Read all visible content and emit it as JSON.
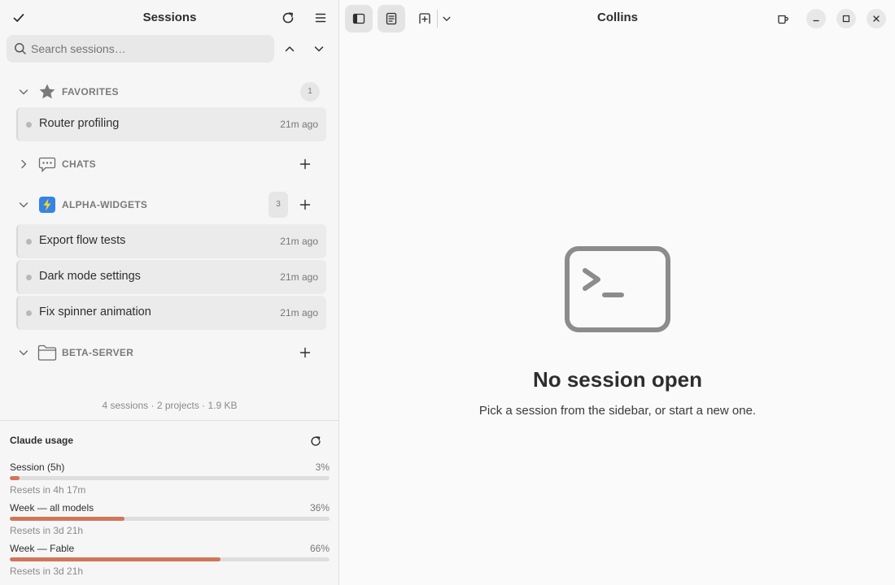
{
  "sidebar": {
    "title": "Sessions",
    "search": {
      "placeholder": "Search sessions…",
      "value": ""
    },
    "sections": {
      "favorites": {
        "label": "FAVORITES",
        "count": "1",
        "icon": "star-icon"
      },
      "chats": {
        "label": "CHATS",
        "icon": "chat-bubble-icon"
      },
      "alpha": {
        "label": "ALPHA-WIDGETS",
        "count": "3",
        "icon": "lightning-icon",
        "icon_color": "#3584e4"
      },
      "beta": {
        "label": "BETA-SERVER",
        "icon": "folder-icon"
      }
    },
    "favorites_sessions": [
      {
        "name": "Router profiling",
        "time": "21m ago"
      }
    ],
    "alpha_sessions": [
      {
        "name": "Export flow tests",
        "time": "21m ago"
      },
      {
        "name": "Dark mode settings",
        "time": "21m ago"
      },
      {
        "name": "Fix spinner animation",
        "time": "21m ago"
      }
    ],
    "summary": "4 sessions · 2 projects · 1.9 KB"
  },
  "usage": {
    "title": "Claude usage",
    "accent": "#d0775a",
    "items": [
      {
        "label": "Session (5h)",
        "percent_label": "3%",
        "percent": 3,
        "reset": "Resets in 4h 17m"
      },
      {
        "label": "Week — all models",
        "percent_label": "36%",
        "percent": 36,
        "reset": "Resets in 3d 21h"
      },
      {
        "label": "Week — Fable",
        "percent_label": "66%",
        "percent": 66,
        "reset": "Resets in 3d 21h"
      }
    ]
  },
  "main": {
    "title": "Collins",
    "empty": {
      "icon": "terminal-icon",
      "title": "No session open",
      "subtitle": "Pick a session from the sidebar, or start a new one."
    }
  }
}
